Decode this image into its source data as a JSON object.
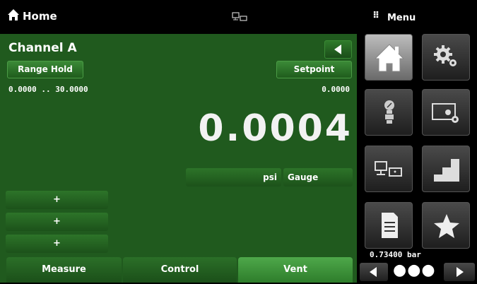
{
  "header": {
    "title": "Home",
    "menu_title": "Menu",
    "menu_grip": "⠿"
  },
  "channel": {
    "title": "Channel A",
    "range_hold_label": "Range Hold",
    "setpoint_label": "Setpoint",
    "range_text": "0.0000 .. 30.0000",
    "setpoint_value": "0.0000",
    "reading": "0.0004",
    "unit": "psi",
    "mode": "Gauge",
    "plus_buttons": [
      "+",
      "+",
      "+"
    ]
  },
  "tabs": [
    {
      "label": "Measure"
    },
    {
      "label": "Control"
    },
    {
      "label": "Vent"
    }
  ],
  "menu": {
    "baro_reading": "0.73400  bar",
    "dots": "●●●"
  },
  "colors": {
    "panel": "#205a1e",
    "accent": "#4ea84a",
    "background": "#000000"
  }
}
